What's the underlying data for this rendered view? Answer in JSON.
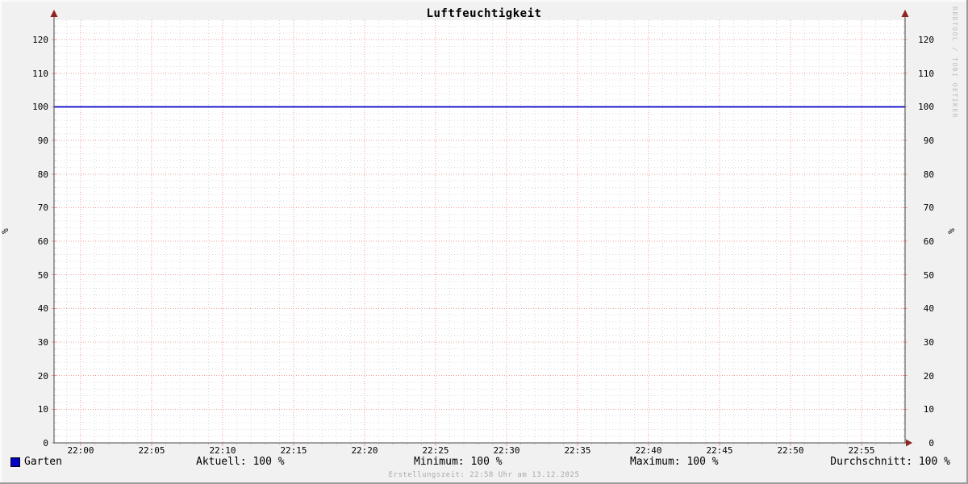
{
  "watermark": "RRDTOOL / TOBI OETIKER",
  "colors": {
    "canvas_bg": "#f1f1f1",
    "plot_bg": "#ffffff",
    "major_grid": "#f19e9e",
    "minor_grid": "#d8d8d8",
    "axis": "#454545",
    "arrow": "#8f2420",
    "series": "#0000c8",
    "text": "#000000",
    "muted": "#a8a8a8",
    "watermark": "#bcbcbc"
  },
  "legend": {
    "label": "Garten",
    "swatch_color": "#0000c8"
  },
  "stats": {
    "aktuell": "Aktuell: 100 %",
    "minimum": "Minimum: 100 %",
    "maximum": "Maximum: 100 %",
    "durchschnitt": "Durchschnitt: 100 %"
  },
  "footer": {
    "text": "Erstellungszeit: 22:58 Uhr am 13.12.2025"
  },
  "chart_data": {
    "type": "line",
    "title": "Luftfeuchtigkeit",
    "ylabel": "%",
    "ylabel_right": "%",
    "x_ticks": [
      "22:00",
      "22:05",
      "22:10",
      "22:15",
      "22:20",
      "22:25",
      "22:30",
      "22:35",
      "22:40",
      "22:45",
      "22:50",
      "22:55"
    ],
    "y_ticks": [
      0,
      10,
      20,
      30,
      40,
      50,
      60,
      70,
      80,
      90,
      100,
      110,
      120
    ],
    "ylim": [
      0,
      125.8
    ],
    "y_minor_step": 2,
    "x_minor_per_major": 5,
    "grid": true,
    "legend_position": "bottom-left",
    "series": [
      {
        "name": "Garten",
        "color": "#0000c8",
        "values": [
          100,
          100,
          100,
          100,
          100,
          100,
          100,
          100,
          100,
          100,
          100,
          100
        ]
      }
    ],
    "stats": {
      "aktuell": "100 %",
      "minimum": "100 %",
      "maximum": "100 %",
      "durchschnitt": "100 %"
    }
  }
}
